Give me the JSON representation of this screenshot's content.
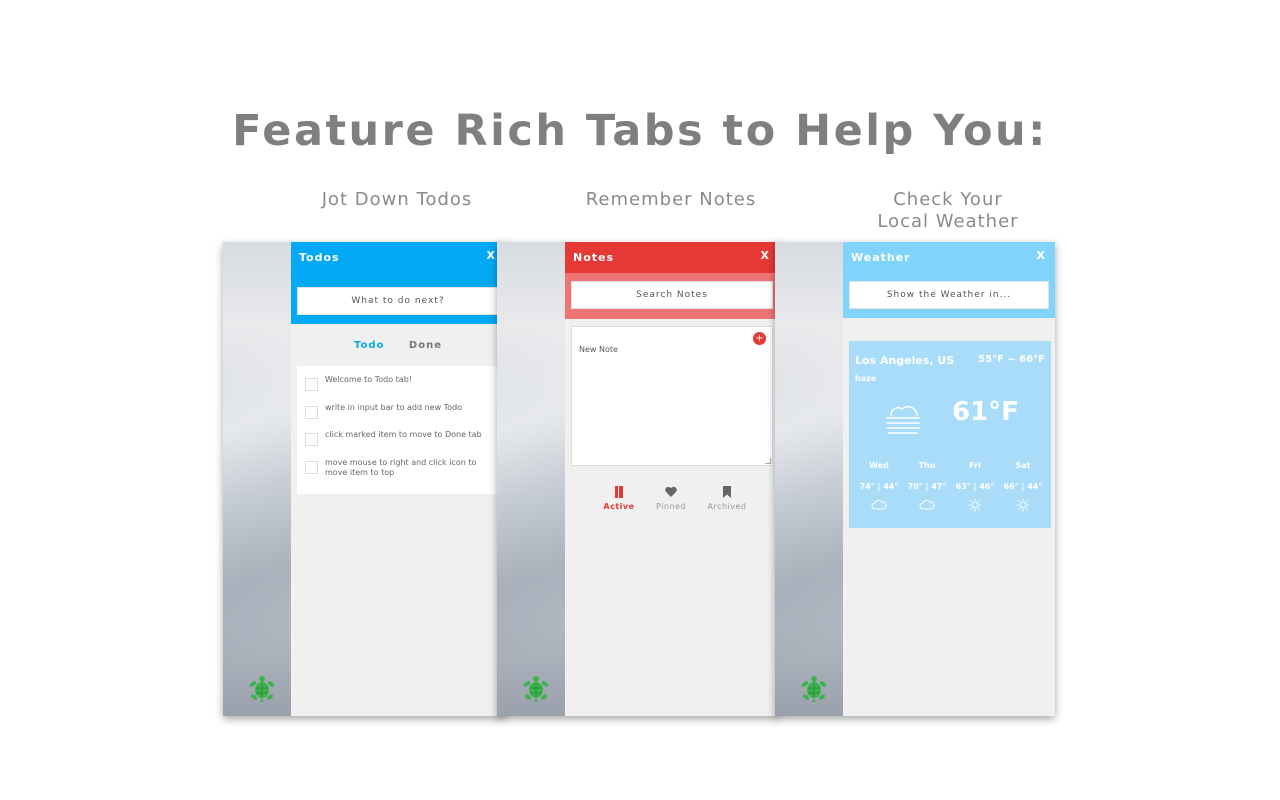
{
  "headline": "Feature Rich Tabs to Help You:",
  "captions": {
    "todos": "Jot Down Todos",
    "notes": "Remember Notes",
    "weather_line1": "Check Your",
    "weather_line2": "Local Weather"
  },
  "colors": {
    "todos_accent": "#03a9f4",
    "notes_accent": "#e53935",
    "notes_strip": "#ef7474",
    "weather_accent": "#80d4fb",
    "weather_card": "#a8dcf8",
    "turtle": "#3cb34a"
  },
  "todos": {
    "title": "Todos",
    "close": "X",
    "input_placeholder": "What to do next?",
    "tab_todo": "Todo",
    "tab_done": "Done",
    "items": [
      "Welcome to Todo tab!",
      "write in input bar to add new Todo",
      "click marked item to move to Done tab",
      "move mouse to right and click icon to move item to top"
    ]
  },
  "notes": {
    "title": "Notes",
    "close": "X",
    "search_placeholder": "Search Notes",
    "note_text": "New Note",
    "add_icon": "+",
    "nav": {
      "active": "Active",
      "pinned": "Pinned",
      "archived": "Archived"
    }
  },
  "weather": {
    "title": "Weather",
    "close": "X",
    "input_placeholder": "Show the Weather in...",
    "city": "Los Angeles, US",
    "range": "55°F ~ 66°F",
    "description": "haze",
    "current_temp": "61°F",
    "forecast": [
      {
        "day": "Wed",
        "temps": "74° | 44°",
        "icon": "cloud-icon"
      },
      {
        "day": "Thu",
        "temps": "70° | 47°",
        "icon": "cloud-icon"
      },
      {
        "day": "Fri",
        "temps": "63° | 46°",
        "icon": "sun-icon"
      },
      {
        "day": "Sat",
        "temps": "66° | 44°",
        "icon": "sun-icon"
      }
    ]
  }
}
